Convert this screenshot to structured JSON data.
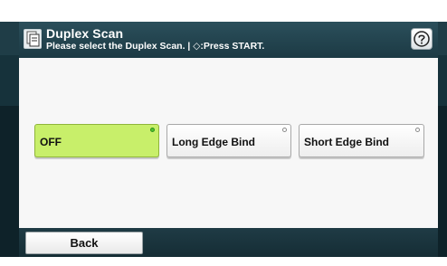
{
  "header": {
    "title": "Duplex Scan",
    "subtitle": "Please select the Duplex Scan. | ◇:Press START.",
    "help_icon": "question-mark-icon",
    "scan_icon": "duplex-scan-icon"
  },
  "options": [
    {
      "label": "OFF",
      "selected": true
    },
    {
      "label": "Long Edge Bind",
      "selected": false
    },
    {
      "label": "Short Edge Bind",
      "selected": false
    }
  ],
  "footer": {
    "back_label": "Back"
  },
  "colors": {
    "header_bg": "#24444f",
    "selected_bg": "#c8ef6a",
    "selected_dot": "#4fc52f"
  }
}
